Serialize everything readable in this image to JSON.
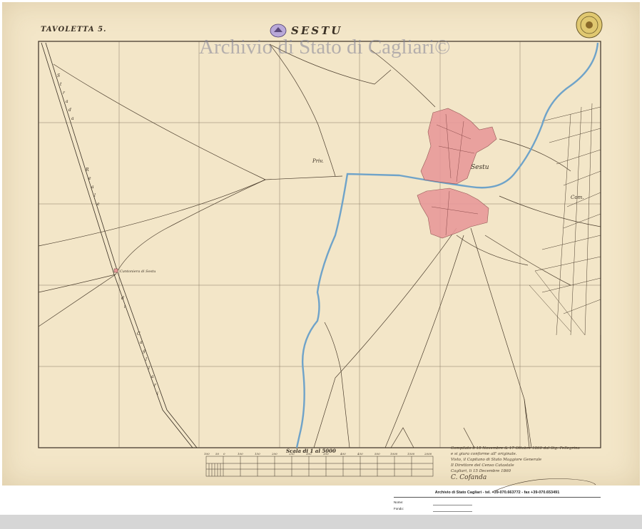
{
  "sheet_label": "TAVOLETTA 5.",
  "map_title": "SESTU",
  "watermark": "Archivio di Stato di Cagliari©",
  "labels": {
    "town": "Sestu",
    "priv": "Priv.",
    "com": "Com.",
    "road": "Strada Reale di Cagliari",
    "cantoniera": "Cantoniera di Sestu"
  },
  "scale": {
    "title": "Scala di 1 al 5000",
    "ticks": [
      "100",
      "50",
      "0",
      "100",
      "150",
      "200",
      "250",
      "300",
      "350",
      "400",
      "450",
      "500",
      "1000",
      "1500",
      "2000"
    ]
  },
  "certification": [
    "Compilato li 15 Novembre & 17 Ottobre 1860 dal Sig. Pellegrino",
    "e si giura conforme all' originale.",
    "Visto, il Capitano di Stato Maggiore Generale",
    "Il Direttore del Censo Catastale",
    "Cagliari, li 15 Decembre 1860",
    "C. Cofanda"
  ],
  "archive": {
    "header": "Archivio di Stato Cagliari - tel. +39-070.663772 - fax +39-070.653491",
    "name_label": "Nome:",
    "fund_label": "Fondo:"
  },
  "colors": {
    "paper": "#f3e6c8",
    "river": "#6fa3c9",
    "settlement": "#e99a9a",
    "ink": "#3a3024"
  },
  "icons": {
    "seal": "embossed-seal-icon",
    "stamp": "archive-stamp-icon"
  }
}
